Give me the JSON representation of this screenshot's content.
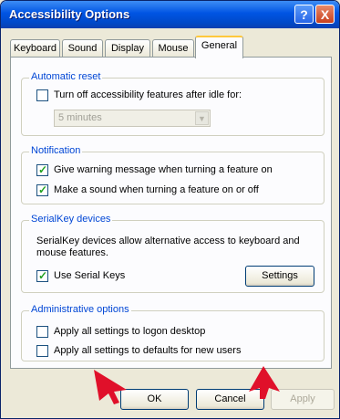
{
  "window": {
    "title": "Accessibility Options"
  },
  "titlebar": {
    "help_label": "?",
    "close_label": "X"
  },
  "tabs": [
    {
      "label": "Keyboard"
    },
    {
      "label": "Sound"
    },
    {
      "label": "Display"
    },
    {
      "label": "Mouse"
    },
    {
      "label": "General"
    }
  ],
  "active_tab": "General",
  "automatic_reset": {
    "title": "Automatic reset",
    "checkbox_label": "Turn off accessibility features after idle for:",
    "checked": false,
    "idle_select_value": "5 minutes"
  },
  "notification": {
    "title": "Notification",
    "warning_label": "Give warning message when turning a feature on",
    "warning_checked": true,
    "sound_label": "Make a sound when turning a feature on or off",
    "sound_checked": true
  },
  "serialkey": {
    "title": "SerialKey devices",
    "description_line1": "SerialKey devices allow alternative access to keyboard and",
    "description_line2": "mouse features.",
    "use_label": "Use Serial Keys",
    "use_checked": true,
    "settings_label": "Settings"
  },
  "administrative": {
    "title": "Administrative options",
    "logon_label": "Apply all settings to logon desktop",
    "logon_checked": false,
    "defaults_label": "Apply all settings to defaults for new users",
    "defaults_checked": false
  },
  "buttons": {
    "ok_label": "OK",
    "cancel_label": "Cancel",
    "apply_label": "Apply"
  },
  "colors": {
    "title_bar": "#0054e3",
    "group_title": "#0046d5",
    "arrow": "#e0102a",
    "check": "#21a121"
  }
}
